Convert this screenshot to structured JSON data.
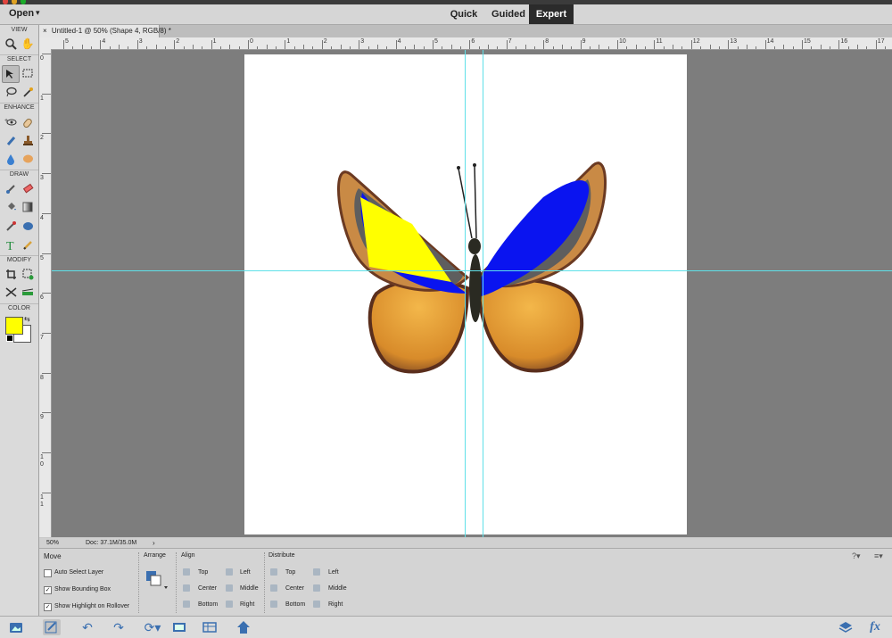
{
  "menubar": {
    "open_label": "Open",
    "modes": [
      "Quick",
      "Guided",
      "Expert"
    ]
  },
  "doc_tab": {
    "close": "×",
    "title": "Untitled-1 @ 50% (Shape 4, RGB/8) *"
  },
  "toolbox": {
    "sections": [
      "VIEW",
      "SELECT",
      "ENHANCE",
      "DRAW",
      "MODIFY",
      "COLOR"
    ],
    "foreground_color": "#ffff00",
    "background_color": "#ffffff"
  },
  "rulers": {
    "top_numbers": [
      "5",
      "4",
      "3",
      "2",
      "1",
      "0",
      "1",
      "2",
      "3",
      "4",
      "5",
      "6",
      "7",
      "8",
      "9",
      "10",
      "11",
      "12",
      "13",
      "14",
      "15",
      "16",
      "17"
    ],
    "left_numbers": [
      "0",
      "1",
      "2",
      "3",
      "4",
      "5",
      "6",
      "7",
      "8",
      "9",
      "1\n0",
      "1\n1"
    ]
  },
  "status": {
    "zoom": "50%",
    "doc": "Doc: 37.1M/35.0M"
  },
  "options": {
    "move_title": "Move",
    "auto_select": "Auto Select Layer",
    "bounding_box": "Show Bounding Box",
    "highlight": "Show Highlight on Rollover",
    "arrange_title": "Arrange",
    "align_title": "Align",
    "align": [
      "Top",
      "Center",
      "Bottom",
      "Left",
      "Middle",
      "Right"
    ],
    "distribute_title": "Distribute",
    "distribute": [
      "Top",
      "Center",
      "Bottom",
      "Left",
      "Middle",
      "Right"
    ],
    "auto_select_checked": false,
    "bounding_box_checked": true,
    "highlight_checked": true
  },
  "bottombar": {
    "fx_label": "fx"
  },
  "colors": {
    "wing_blue": "#0a14f0",
    "wing_yellow": "#ffff00",
    "wing_orange": "#d88b2a",
    "guide": "#5fe0e8"
  }
}
